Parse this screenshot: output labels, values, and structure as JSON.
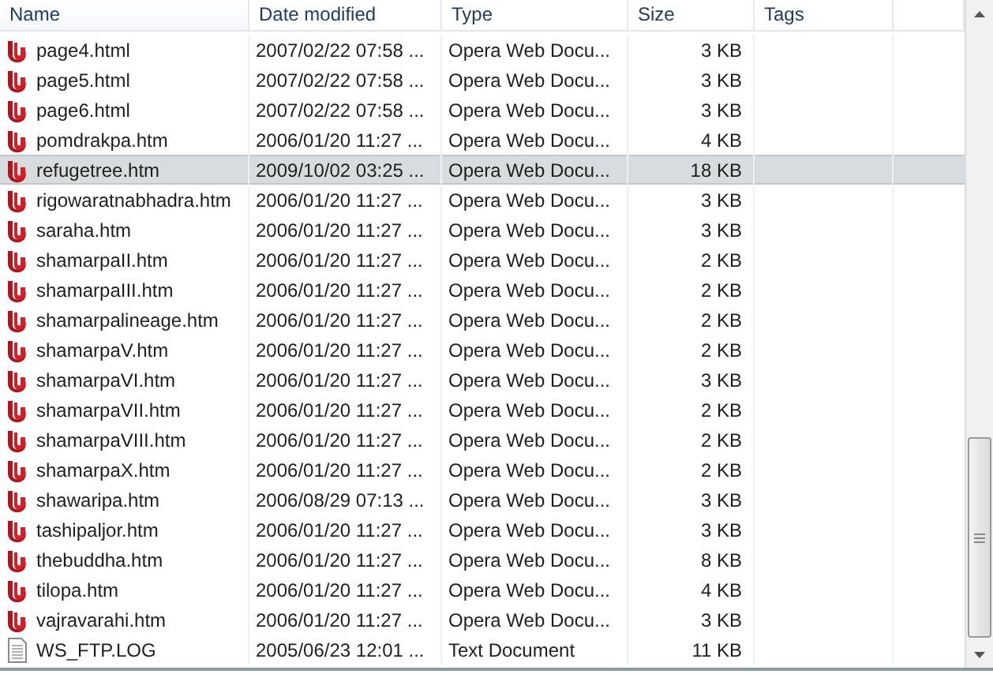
{
  "columns": [
    {
      "label": "Name"
    },
    {
      "label": "Date modified"
    },
    {
      "label": "Type"
    },
    {
      "label": "Size"
    },
    {
      "label": "Tags"
    }
  ],
  "rows": [
    {
      "kind": "opera",
      "name": "page4.html",
      "date": "2007/02/22 07:58 ...",
      "type": "Opera Web Docu...",
      "size": "3 KB",
      "selected": false
    },
    {
      "kind": "opera",
      "name": "page5.html",
      "date": "2007/02/22 07:58 ...",
      "type": "Opera Web Docu...",
      "size": "3 KB",
      "selected": false
    },
    {
      "kind": "opera",
      "name": "page6.html",
      "date": "2007/02/22 07:58 ...",
      "type": "Opera Web Docu...",
      "size": "3 KB",
      "selected": false
    },
    {
      "kind": "opera",
      "name": "pomdrakpa.htm",
      "date": "2006/01/20 11:27 ...",
      "type": "Opera Web Docu...",
      "size": "4 KB",
      "selected": false
    },
    {
      "kind": "opera",
      "name": "refugetree.htm",
      "date": "2009/10/02 03:25 ...",
      "type": "Opera Web Docu...",
      "size": "18 KB",
      "selected": true
    },
    {
      "kind": "opera",
      "name": "rigowaratnabhadra.htm",
      "date": "2006/01/20 11:27 ...",
      "type": "Opera Web Docu...",
      "size": "3 KB",
      "selected": false
    },
    {
      "kind": "opera",
      "name": "saraha.htm",
      "date": "2006/01/20 11:27 ...",
      "type": "Opera Web Docu...",
      "size": "3 KB",
      "selected": false
    },
    {
      "kind": "opera",
      "name": "shamarpaII.htm",
      "date": "2006/01/20 11:27 ...",
      "type": "Opera Web Docu...",
      "size": "2 KB",
      "selected": false
    },
    {
      "kind": "opera",
      "name": "shamarpaIII.htm",
      "date": "2006/01/20 11:27 ...",
      "type": "Opera Web Docu...",
      "size": "2 KB",
      "selected": false
    },
    {
      "kind": "opera",
      "name": "shamarpalineage.htm",
      "date": "2006/01/20 11:27 ...",
      "type": "Opera Web Docu...",
      "size": "2 KB",
      "selected": false
    },
    {
      "kind": "opera",
      "name": "shamarpaV.htm",
      "date": "2006/01/20 11:27 ...",
      "type": "Opera Web Docu...",
      "size": "2 KB",
      "selected": false
    },
    {
      "kind": "opera",
      "name": "shamarpaVI.htm",
      "date": "2006/01/20 11:27 ...",
      "type": "Opera Web Docu...",
      "size": "3 KB",
      "selected": false
    },
    {
      "kind": "opera",
      "name": "shamarpaVII.htm",
      "date": "2006/01/20 11:27 ...",
      "type": "Opera Web Docu...",
      "size": "2 KB",
      "selected": false
    },
    {
      "kind": "opera",
      "name": "shamarpaVIII.htm",
      "date": "2006/01/20 11:27 ...",
      "type": "Opera Web Docu...",
      "size": "2 KB",
      "selected": false
    },
    {
      "kind": "opera",
      "name": "shamarpaX.htm",
      "date": "2006/01/20 11:27 ...",
      "type": "Opera Web Docu...",
      "size": "2 KB",
      "selected": false
    },
    {
      "kind": "opera",
      "name": "shawaripa.htm",
      "date": "2006/08/29 07:13 ...",
      "type": "Opera Web Docu...",
      "size": "3 KB",
      "selected": false
    },
    {
      "kind": "opera",
      "name": "tashipaljor.htm",
      "date": "2006/01/20 11:27 ...",
      "type": "Opera Web Docu...",
      "size": "3 KB",
      "selected": false
    },
    {
      "kind": "opera",
      "name": "thebuddha.htm",
      "date": "2006/01/20 11:27 ...",
      "type": "Opera Web Docu...",
      "size": "8 KB",
      "selected": false
    },
    {
      "kind": "opera",
      "name": "tilopa.htm",
      "date": "2006/01/20 11:27 ...",
      "type": "Opera Web Docu...",
      "size": "4 KB",
      "selected": false
    },
    {
      "kind": "opera",
      "name": "vajravarahi.htm",
      "date": "2006/01/20 11:27 ...",
      "type": "Opera Web Docu...",
      "size": "3 KB",
      "selected": false
    },
    {
      "kind": "text",
      "name": "WS_FTP.LOG",
      "date": "2005/06/23 12:01 ...",
      "type": "Text Document",
      "size": "11 KB",
      "selected": false
    }
  ]
}
